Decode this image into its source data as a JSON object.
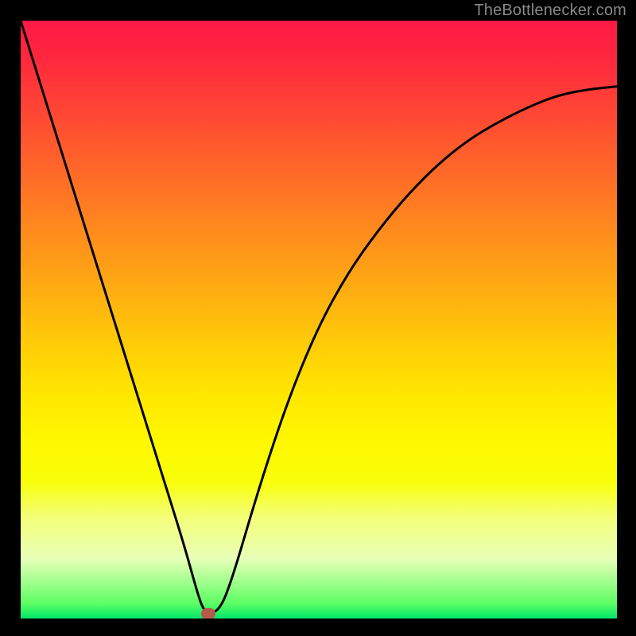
{
  "watermark": "TheBottlenecker.com",
  "chart_data": {
    "type": "line",
    "title": "",
    "xlabel": "",
    "ylabel": "",
    "xlim": [
      0,
      1
    ],
    "ylim": [
      0,
      1
    ],
    "series": [
      {
        "name": "bottleneck-curve",
        "x": [
          0.0,
          0.05,
          0.1,
          0.15,
          0.2,
          0.225,
          0.25,
          0.275,
          0.3,
          0.31,
          0.33,
          0.35,
          0.4,
          0.45,
          0.5,
          0.55,
          0.6,
          0.65,
          0.7,
          0.75,
          0.8,
          0.85,
          0.9,
          0.95,
          1.0
        ],
        "y": [
          1.0,
          0.84,
          0.68,
          0.52,
          0.36,
          0.28,
          0.2,
          0.12,
          0.03,
          0.01,
          0.01,
          0.05,
          0.22,
          0.37,
          0.49,
          0.58,
          0.65,
          0.71,
          0.76,
          0.8,
          0.83,
          0.855,
          0.875,
          0.885,
          0.89
        ]
      }
    ],
    "marker": {
      "x": 0.315,
      "y": 0.008,
      "color": "#b85a4a"
    },
    "gradient": {
      "top": "#ff1846",
      "mid": "#ffe800",
      "bottom": "#00e668"
    }
  }
}
